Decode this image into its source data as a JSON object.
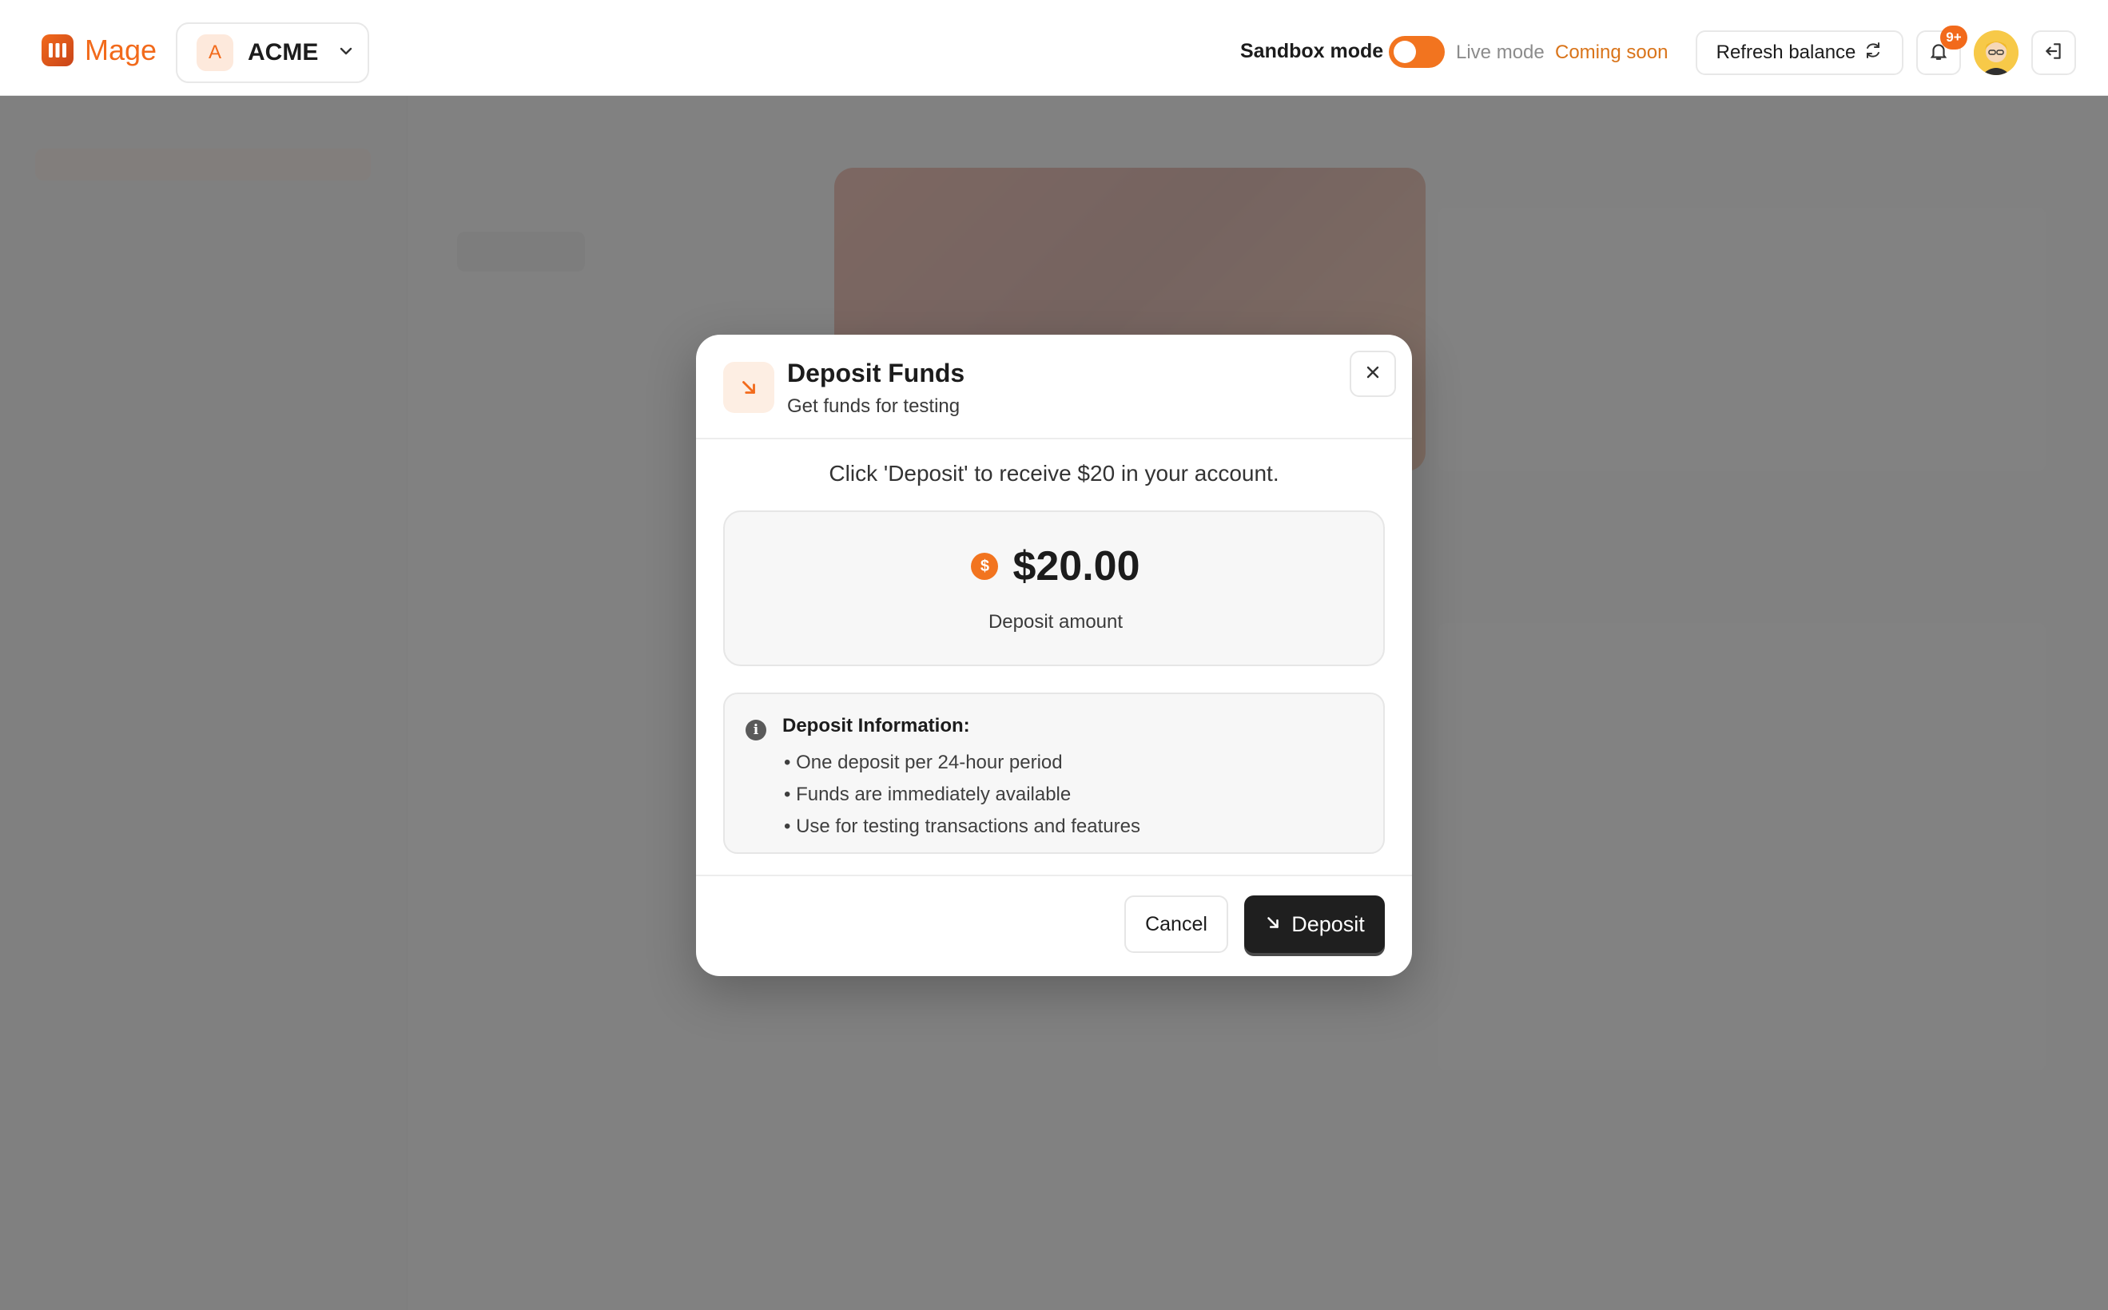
{
  "header": {
    "app_name": "Mage",
    "org_initial": "A",
    "org_name": "ACME",
    "sandbox_label": "Sandbox mode",
    "sandbox_enabled": true,
    "live_label": "Live mode",
    "coming_soon": "Coming soon",
    "refresh_label": "Refresh balance",
    "notification_count": "9+"
  },
  "modal": {
    "title": "Deposit Funds",
    "subtitle": "Get funds for testing",
    "instruction": "Click 'Deposit' to receive $20 in your account.",
    "amount": "$20.00",
    "amount_label": "Deposit amount",
    "info_title": "Deposit Information:",
    "info_items": [
      "• One deposit per 24-hour period",
      "• Funds are immediately available",
      "• Use for testing transactions and features"
    ],
    "cancel_label": "Cancel",
    "deposit_label": "Deposit"
  },
  "colors": {
    "accent": "#f26a1b",
    "dark_button": "#1f1f1f",
    "overlay": "rgba(110,110,110,0.86)"
  }
}
